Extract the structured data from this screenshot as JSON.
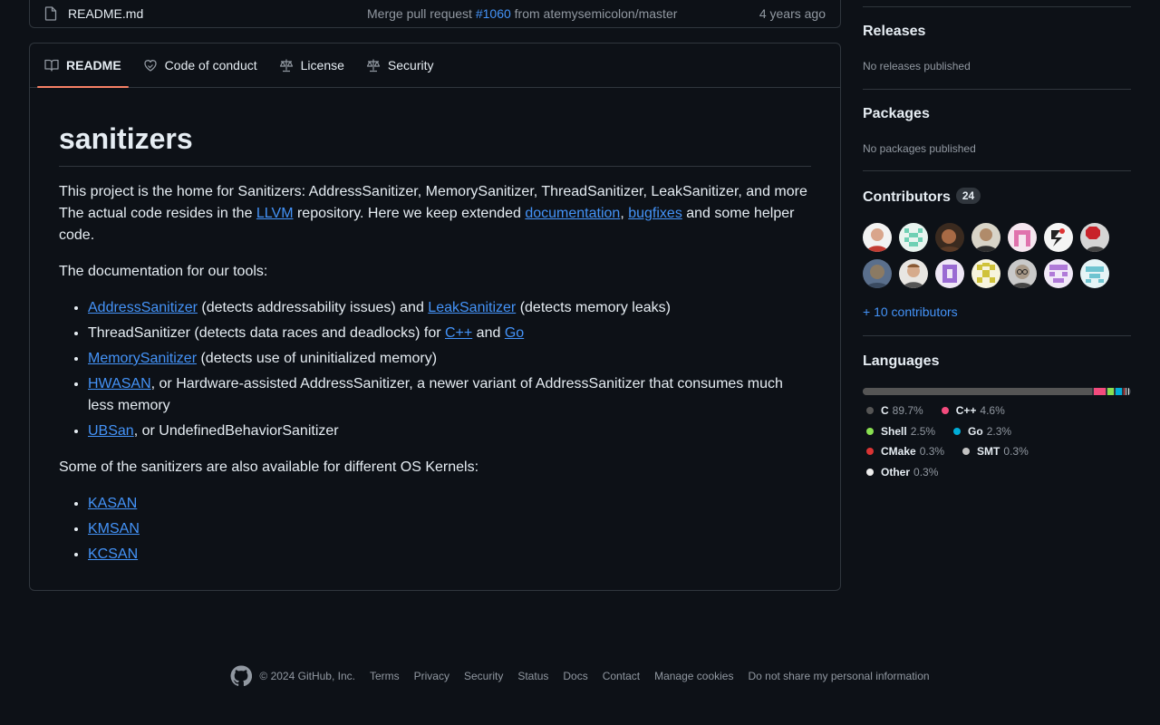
{
  "file_row": {
    "name": "README.md",
    "commit_prefix": "Merge pull request ",
    "commit_pr": "#1060",
    "commit_suffix": " from atemysemicolon/master",
    "age": "4 years ago"
  },
  "tabs": [
    {
      "label": "README",
      "icon": "book-icon",
      "active": true
    },
    {
      "label": "Code of conduct",
      "icon": "heart-icon"
    },
    {
      "label": "License",
      "icon": "scale-icon"
    },
    {
      "label": "Security",
      "icon": "scale-icon"
    }
  ],
  "readme": {
    "title": "sanitizers",
    "intro": {
      "t1": "This project is the home for Sanitizers: AddressSanitizer, MemorySanitizer, ThreadSanitizer, LeakSanitizer, and more The actual code resides in the ",
      "llvm": "LLVM",
      "t2": " repository. Here we keep extended ",
      "documentation": "documentation",
      "t3": ", ",
      "bugfixes": "bugfixes",
      "t4": " and some helper code."
    },
    "tools_heading": "The documentation for our tools:",
    "tools": {
      "asan": {
        "link1": "AddressSanitizer",
        "text1": " (detects addressability issues) and ",
        "link2": "LeakSanitizer",
        "text2": " (detects memory leaks)"
      },
      "tsan": {
        "text1": "ThreadSanitizer (detects data races and deadlocks) for ",
        "link1": "C++",
        "text2": " and ",
        "link2": "Go"
      },
      "msan": {
        "link1": "MemorySanitizer",
        "text1": " (detects use of uninitialized memory)"
      },
      "hwasan": {
        "link1": "HWASAN",
        "text1": ", or Hardware-assisted AddressSanitizer, a newer variant of AddressSanitizer that consumes much less memory"
      },
      "ubsan": {
        "link1": "UBSan",
        "text1": ", or UndefinedBehaviorSanitizer"
      }
    },
    "kernels_heading": "Some of the sanitizers are also available for different OS Kernels:",
    "kernels": [
      "KASAN",
      "KMSAN",
      "KCSAN"
    ]
  },
  "sidebar": {
    "releases": {
      "title": "Releases",
      "text": "No releases published"
    },
    "packages": {
      "title": "Packages",
      "text": "No packages published"
    },
    "contributors": {
      "title": "Contributors",
      "count": "24",
      "more": "+ 10 contributors"
    },
    "languages": {
      "title": "Languages",
      "items": [
        {
          "name": "C",
          "pct": "89.7%",
          "value": 89.7,
          "color": "#555555"
        },
        {
          "name": "C++",
          "pct": "4.6%",
          "value": 4.6,
          "color": "#f34b7d"
        },
        {
          "name": "Shell",
          "pct": "2.5%",
          "value": 2.5,
          "color": "#89e051"
        },
        {
          "name": "Go",
          "pct": "2.3%",
          "value": 2.3,
          "color": "#00add8"
        },
        {
          "name": "CMake",
          "pct": "0.3%",
          "value": 0.3,
          "color": "#da3434"
        },
        {
          "name": "SMT",
          "pct": "0.3%",
          "value": 0.3,
          "color": "#c2c2c2"
        },
        {
          "name": "Other",
          "pct": "0.3%",
          "value": 0.3,
          "color": "#ededed"
        }
      ]
    }
  },
  "footer": {
    "copyright": "© 2024 GitHub, Inc.",
    "links": [
      "Terms",
      "Privacy",
      "Security",
      "Status",
      "Docs",
      "Contact",
      "Manage cookies",
      "Do not share my personal information"
    ]
  }
}
